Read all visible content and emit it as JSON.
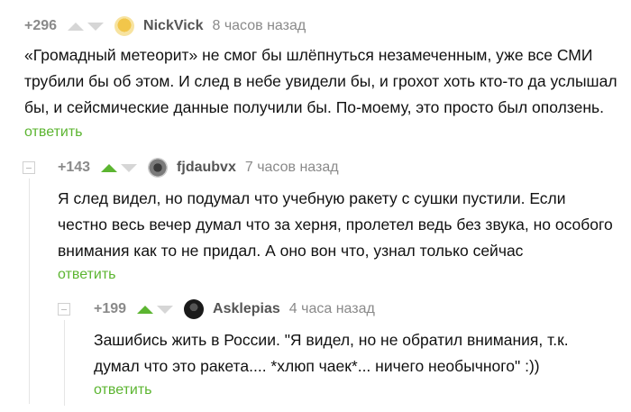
{
  "comments": [
    {
      "score": "+296",
      "author": "NickVick",
      "time": "8 часов назад",
      "vote_up_color": "#d6d6d6",
      "text_lines": [
        "«Громадный метеорит» не смог бы шлёпнуться незамеченным, уже все СМИ",
        "трубили бы об этом. И след в небе увидели бы, и грохот хоть кто-то да услышал",
        "бы, и сейсмические данные получили бы. По-моему, это просто был оползень."
      ],
      "reply_label": "ответить"
    },
    {
      "score": "+143",
      "author": "fjdaubvx",
      "time": "7 часов назад",
      "vote_up_color": "#5cb531",
      "text_lines": [
        "Я след видел, но подумал что учебную ракету с сушки пустили. Если",
        "честно весь вечер думал что за херня, пролетел ведь без звука, но особого",
        "внимания как то не придал. А оно вон что, узнал только сейчас"
      ],
      "reply_label": "ответить"
    },
    {
      "score": "+199",
      "author": "Asklepias",
      "time": "4 часа назад",
      "vote_up_color": "#5cb531",
      "text_lines": [
        "Зашибись жить в России. \"Я видел, но не обратил внимания, т.к.",
        "думал что это ракета.... *хлюп чаек*... ничего необычного\" :))"
      ],
      "reply_label": "ответить"
    }
  ],
  "colors": {
    "accent_green": "#5cb531",
    "muted": "#8a8a8a"
  }
}
